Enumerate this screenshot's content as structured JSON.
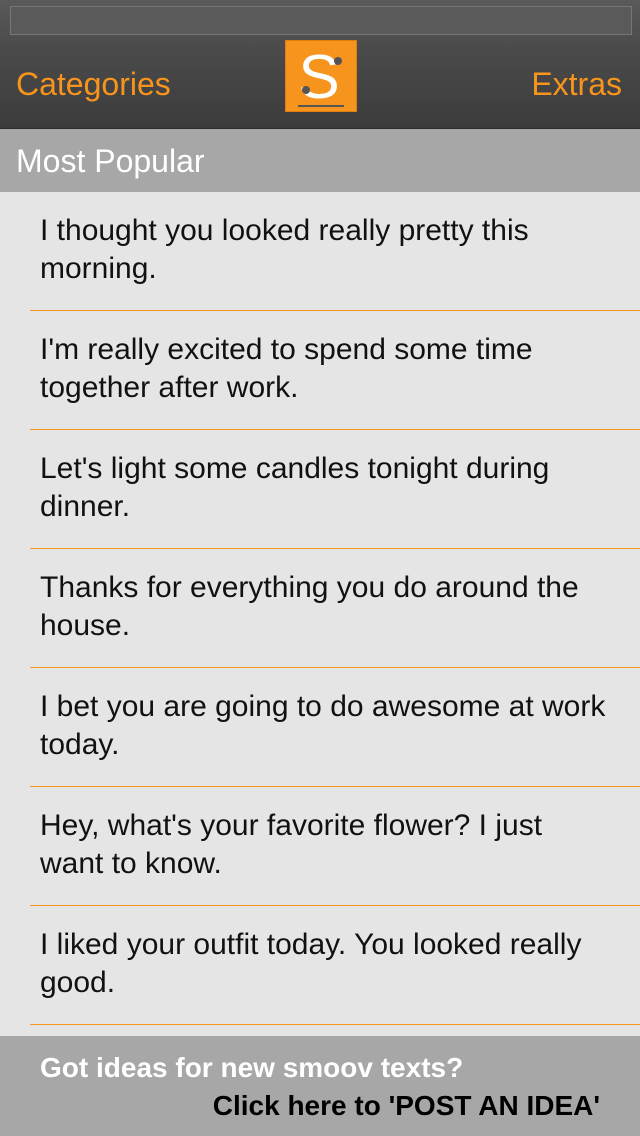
{
  "nav": {
    "left_label": "Categories",
    "right_label": "Extras",
    "logo_letter": "S"
  },
  "section": {
    "title": "Most Popular"
  },
  "items": [
    {
      "text": "I thought you looked really pretty this morning."
    },
    {
      "text": "I'm really excited to spend some time together after work."
    },
    {
      "text": "Let's light some candles tonight during dinner."
    },
    {
      "text": "Thanks for everything you do around the house."
    },
    {
      "text": "I bet you are going to do awesome at work today."
    },
    {
      "text": "Hey, what's your favorite flower? I just want to know."
    },
    {
      "text": "I liked your outfit today. You looked really good."
    }
  ],
  "footer": {
    "line1": "Got ideas for new smoov texts?",
    "line2": "Click here to 'POST AN IDEA'"
  },
  "colors": {
    "accent": "#f7941d",
    "bar": "#4a4a4a",
    "section_bg": "#a7a7a7",
    "list_bg": "#e5e5e5"
  },
  "icons": {
    "logo": "smoov-logo-icon"
  }
}
